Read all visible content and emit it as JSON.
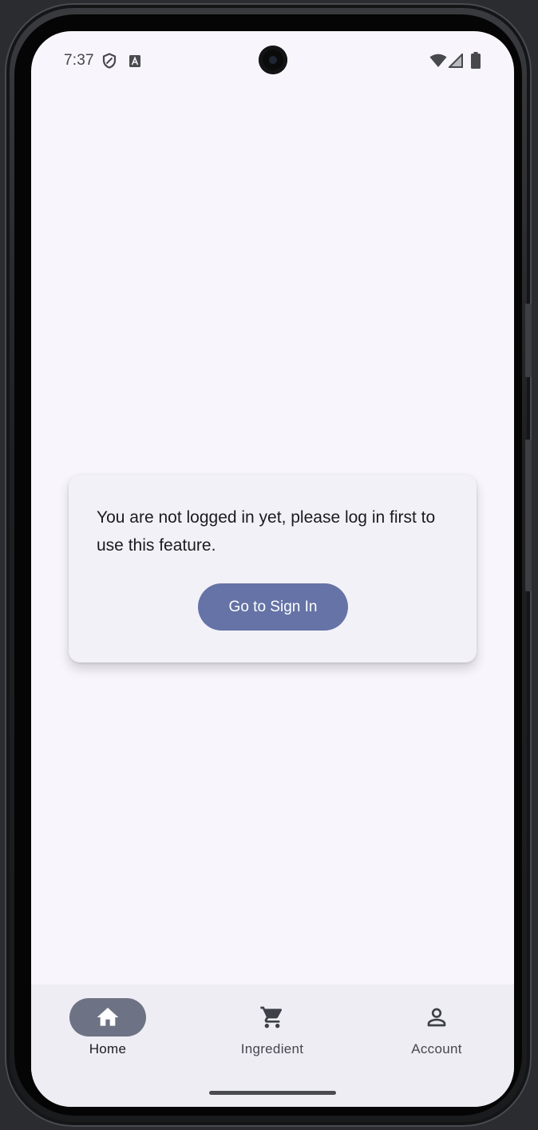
{
  "status_bar": {
    "time": "7:37",
    "left_icons": [
      "shield-icon",
      "keyboard-a-icon"
    ],
    "right_icons": [
      "wifi-icon",
      "cell-signal-icon",
      "battery-icon"
    ]
  },
  "dialog": {
    "message": "You are not logged in yet, please log in first to use this feature.",
    "button_label": "Go to Sign In"
  },
  "bottom_nav": {
    "items": [
      {
        "label": "Home",
        "icon": "home-icon",
        "active": true
      },
      {
        "label": "Ingredient",
        "icon": "cart-icon",
        "active": false
      },
      {
        "label": "Account",
        "icon": "person-icon",
        "active": false
      }
    ]
  },
  "colors": {
    "screen_background": "#f8f6fc",
    "card_background": "#f2f1f8",
    "primary_button": "#6573a6",
    "nav_background": "#efedf4",
    "nav_active_indicator": "#6d7384",
    "text_primary": "#1b1b1f",
    "text_secondary": "#45464f"
  }
}
